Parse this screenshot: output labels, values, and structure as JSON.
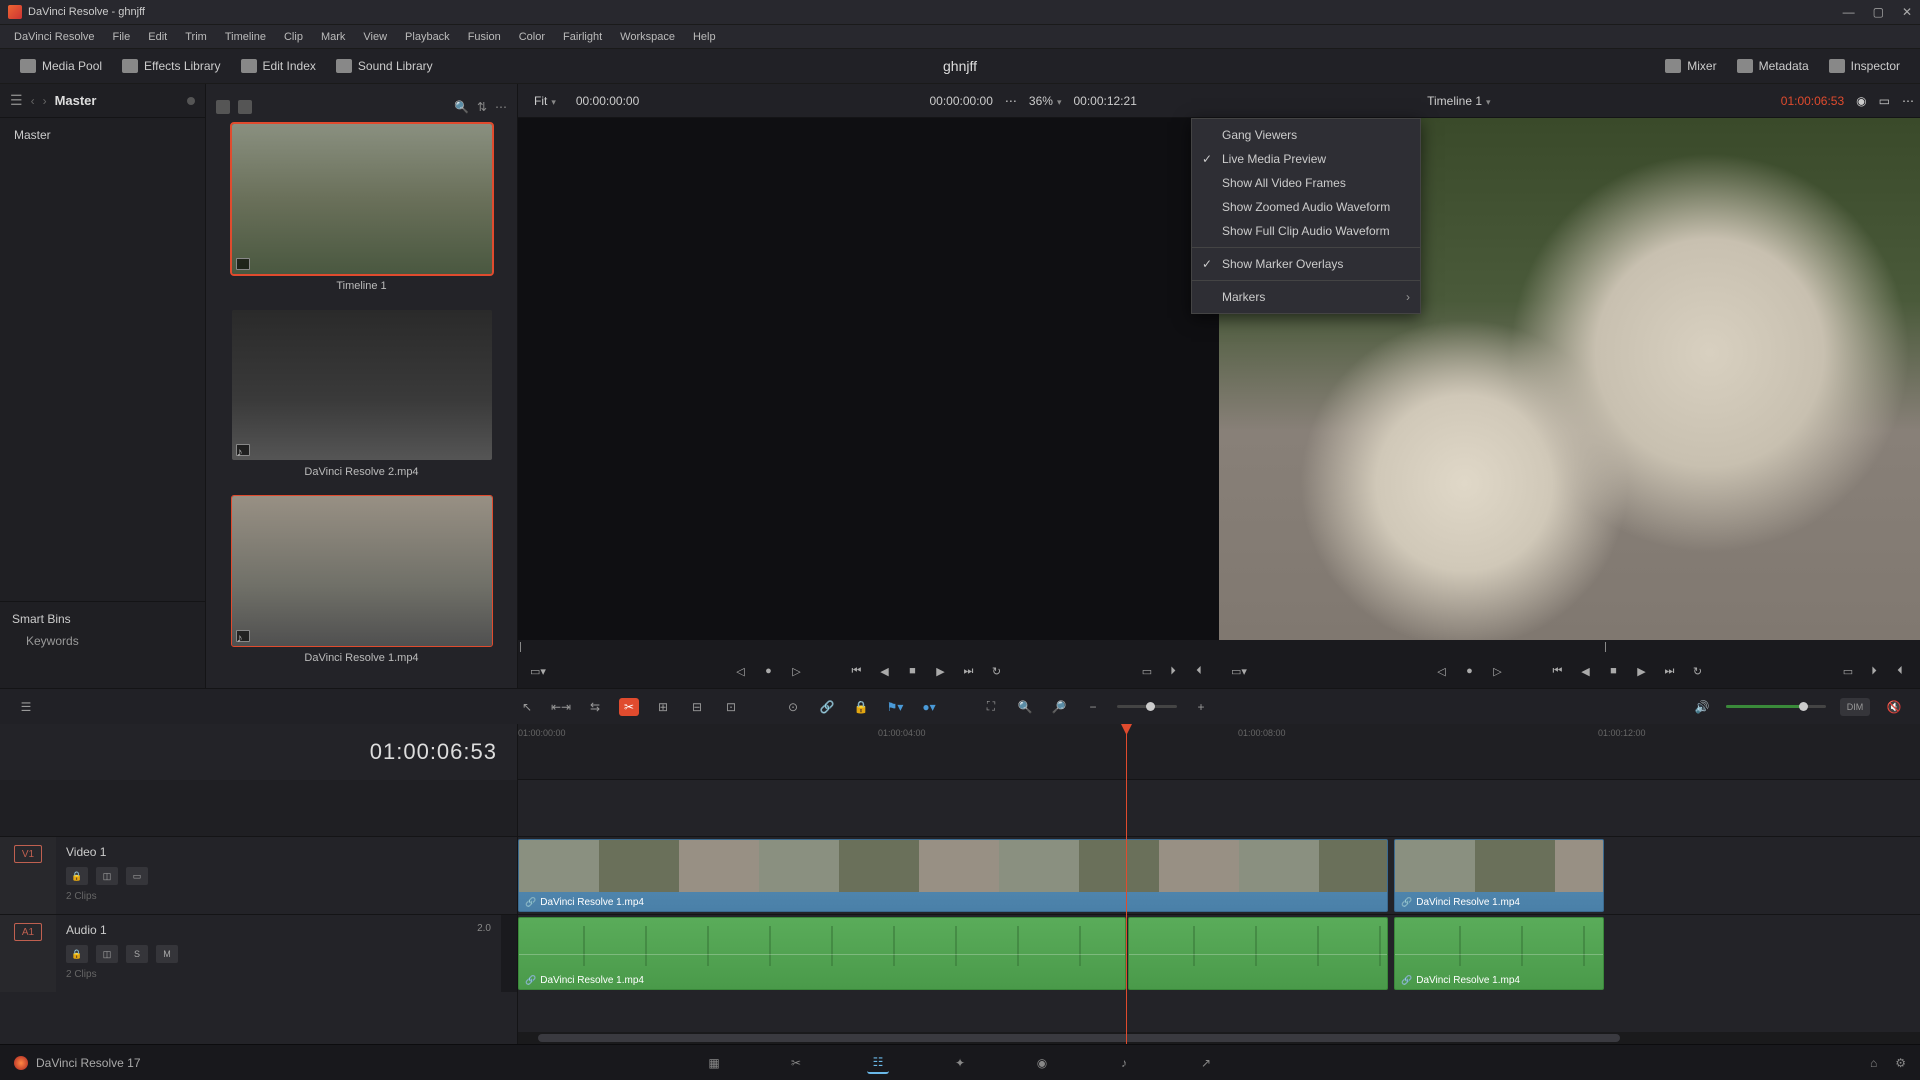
{
  "window_title": "DaVinci Resolve - ghnjff",
  "project_name": "ghnjff",
  "menu": [
    "DaVinci Resolve",
    "File",
    "Edit",
    "Trim",
    "Timeline",
    "Clip",
    "Mark",
    "View",
    "Playback",
    "Fusion",
    "Color",
    "Fairlight",
    "Workspace",
    "Help"
  ],
  "toolbar": {
    "media_pool": "Media Pool",
    "effects_library": "Effects Library",
    "edit_index": "Edit Index",
    "sound_library": "Sound Library",
    "mixer": "Mixer",
    "metadata": "Metadata",
    "inspector": "Inspector"
  },
  "media_pool": {
    "master": "Master",
    "root": "Master",
    "smart_bins": "Smart Bins",
    "keywords": "Keywords"
  },
  "thumbs": [
    {
      "label": "Timeline 1"
    },
    {
      "label": "DaVinci Resolve 2.mp4"
    },
    {
      "label": "DaVinci Resolve 1.mp4"
    }
  ],
  "source_viewer": {
    "fit": "Fit",
    "tc_in": "00:00:00:00",
    "tc_right": "00:00:00:00",
    "zoom_pct": "36%",
    "duration": "00:00:12:21"
  },
  "timeline_viewer": {
    "name": "Timeline 1",
    "tc": "01:00:06:53"
  },
  "context_menu": {
    "gang": "Gang Viewers",
    "live": "Live Media Preview",
    "allframes": "Show All Video Frames",
    "zoomwave": "Show Zoomed Audio Waveform",
    "fullwave": "Show Full Clip Audio Waveform",
    "markerov": "Show Marker Overlays",
    "markers": "Markers"
  },
  "timeline": {
    "big_tc": "01:00:06:53",
    "ruler": [
      "01:00:00:00",
      "",
      "01:00:04:00",
      "",
      "01:00:08:00",
      "",
      "01:00:12:00"
    ],
    "video_track": {
      "tag": "V1",
      "name": "Video 1",
      "meta": "2 Clips"
    },
    "audio_track": {
      "tag": "A1",
      "name": "Audio 1",
      "meta": "2 Clips",
      "ch": "2.0"
    },
    "clip1": "DaVinci Resolve 1.mp4",
    "clip2": "DaVinci Resolve 1.mp4"
  },
  "footer": {
    "version": "DaVinci Resolve 17"
  }
}
